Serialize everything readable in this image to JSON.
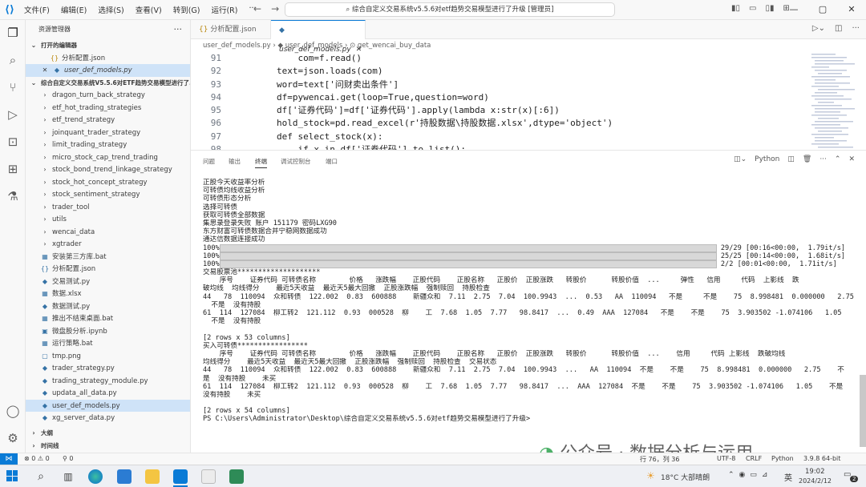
{
  "menu": [
    "文件(F)",
    "编辑(E)",
    "选择(S)",
    "查看(V)",
    "转到(G)",
    "运行(R)",
    "···"
  ],
  "command_center": "综合自定义交易系统v5.5.6对etf趋势交易模型进行了升级 [管理员]",
  "explorer": {
    "title": "资源管理器",
    "open_editors_label": "打开的编辑器",
    "open_editors": [
      "分析配置.json",
      "user_def_models.py"
    ],
    "root_label": "综合自定义交易系统V5.5.6对ETF趋势交易模型进行了...",
    "items": [
      {
        "icon": "›",
        "name": "dragon_turn_back_strategy",
        "type": "folder"
      },
      {
        "icon": "›",
        "name": "etf_hot_trading_strategies",
        "type": "folder"
      },
      {
        "icon": "›",
        "name": "etf_trend_strategy",
        "type": "folder"
      },
      {
        "icon": "›",
        "name": "joinquant_trader_strategy",
        "type": "folder"
      },
      {
        "icon": "›",
        "name": "limit_trading_strategy",
        "type": "folder"
      },
      {
        "icon": "›",
        "name": "micro_stock_cap_trend_trading",
        "type": "folder"
      },
      {
        "icon": "›",
        "name": "stock_bond_trend_linkage_strategy",
        "type": "folder"
      },
      {
        "icon": "›",
        "name": "stock_hot_concept_strategy",
        "type": "folder"
      },
      {
        "icon": "›",
        "name": "stock_sentiment_strategy",
        "type": "folder"
      },
      {
        "icon": "›",
        "name": "trader_tool",
        "type": "folder"
      },
      {
        "icon": "›",
        "name": "utils",
        "type": "folder"
      },
      {
        "icon": "›",
        "name": "wencai_data",
        "type": "folder"
      },
      {
        "icon": "›",
        "name": "xgtrader",
        "type": "folder"
      },
      {
        "icon": "▦",
        "name": "安装第三方库.bat",
        "type": "file"
      },
      {
        "icon": "{}",
        "name": "分析配置.json",
        "type": "file"
      },
      {
        "icon": "◆",
        "name": "交易测试.py",
        "type": "file"
      },
      {
        "icon": "▦",
        "name": "数据.xlsx",
        "type": "file"
      },
      {
        "icon": "◆",
        "name": "数据测试.py",
        "type": "file"
      },
      {
        "icon": "▦",
        "name": "推出不结束桌面.bat",
        "type": "file"
      },
      {
        "icon": "▣",
        "name": "微盘股分析.ipynb",
        "type": "file"
      },
      {
        "icon": "▦",
        "name": "运行策略.bat",
        "type": "file"
      },
      {
        "icon": "▢",
        "name": "tmp.png",
        "type": "file"
      },
      {
        "icon": "◆",
        "name": "trader_strategy.py",
        "type": "file"
      },
      {
        "icon": "◆",
        "name": "trading_strategy_module.py",
        "type": "file"
      },
      {
        "icon": "◆",
        "name": "updata_all_data.py",
        "type": "file"
      },
      {
        "icon": "◆",
        "name": "user_def_models.py",
        "type": "file",
        "selected": true
      },
      {
        "icon": "◆",
        "name": "xg_server_data.py",
        "type": "file"
      }
    ],
    "outline_label": "大纲",
    "timeline_label": "时间线"
  },
  "tabs": [
    "分析配置.json",
    "user_def_models.py"
  ],
  "breadcrumb": "user_def_models.py  ›  ◆ user_def_models  ›  ⊙ get_wencai_buy_data",
  "code": [
    {
      "n": "91",
      "t": "    com=f.read()"
    },
    {
      "n": "92",
      "t": "text=json.loads(com)"
    },
    {
      "n": "93",
      "t": "word=text['问财卖出条件']"
    },
    {
      "n": "94",
      "t": "df=pywencai.get(loop=True,question=word)"
    },
    {
      "n": "95",
      "t": "df['证券代码']=df['证券代码'].apply(lambda x:str(x)[:6])"
    },
    {
      "n": "96",
      "t": "hold_stock=pd.read_excel(r'持股数据\\持股数据.xlsx',dtype='object')"
    },
    {
      "n": "97",
      "t": "def select_stock(x):"
    },
    {
      "n": "98",
      "t": "    if x in df['证券代码'].to_list():"
    }
  ],
  "panel_tabs": [
    "问题",
    "输出",
    "终端",
    "调试控制台",
    "端口"
  ],
  "panel_shell": "Python",
  "terminal": [
    "正股今天收益率分析",
    "可转债均线收益分析",
    "可转债形态分析",
    "选择可转债",
    "获取可转债全部数据",
    "集思录登录失败 账户 151179 密码LXG90",
    "东方财富可转债数据合并宁稳网数据成功",
    "通达信数据连接成功",
    "PROGRESS|100%| 29/29 [00:16<00:00,  1.79it/s]",
    "PROGRESS|100%| 25/25 [00:14<00:00,  1.68it/s]",
    "PROGRESS|100%| 2/2 [00:01<00:00,  1.71it/s]",
    "交易股票池********************",
    "    序号    证券代码 可转债名称        价格   涨跌幅    正股代码    正股名称   正股价  正股涨跌   转股价      转股价值  ...     弹性   信用     代码  上影线  跌",
    "破均线  均线得分    最近5天收益  最近天5最大回撤  正股涨跌幅  强制赎回  持股检查",
    "44   78  110094  众和转债  122.002  0.83  600888    新疆众和  7.11  2.75  7.04  100.9943  ...  0.53   AA  110094   不是     不是    75  8.998481  0.000000   2.75",
    "  不是  没有持股",
    "61  114  127084  柳工转2  121.112  0.93  000528  柳    工  7.68  1.05  7.77   98.8417  ...  0.49  AAA  127084   不是    不是    75  3.903502 -1.074106   1.05",
    "  不是  没有持股",
    "",
    "[2 rows x 53 columns]",
    "买入可转债*****************",
    "    序号    证券代码 可转债名称        价格   涨跌幅    正股代码    正股名称   正股价  正股涨跌   转股价      转股价值  ...    信用     代码 上影线  跌破均线",
    "均线得分    最近5天收益  最近天5最大回撤  正股涨跌幅  强制赎回  持股检查  交易状态",
    "44   78  110094  众和转债  122.002  0.83  600888    新疆众和  7.11  2.75  7.04  100.9943  ...   AA  110094  不是    不是    75  8.998481  0.000000   2.75    不",
    "是  没有持股    未买",
    "61  114  127084  柳工转2  121.112  0.93  000528  柳    工  7.68  1.05  7.77   98.8417  ...  AAA  127084  不是    不是    75  3.903502 -1.074106   1.05    不是",
    "没有持股    未买",
    "",
    "[2 rows x 54 columns]",
    "PS C:\\Users\\Administrator\\Desktop\\综合自定义交易系统v5.5.6对etf趋势交易模型进行了升级>"
  ],
  "watermark": "公众号 · 数据分析与运用",
  "status": {
    "errors": "⊗ 0 ⚠ 0",
    "ports": "⚲ 0",
    "cursor": "行 76，列 36",
    "encoding": "UTF-8",
    "eol": "CRLF",
    "lang": "Python",
    "interpreter": "3.9.8 64-bit"
  },
  "taskbar": {
    "weather": "18°C 大部晴朗",
    "ime": "英",
    "time": "19:02",
    "date": "2024/2/12",
    "notif": "2"
  }
}
